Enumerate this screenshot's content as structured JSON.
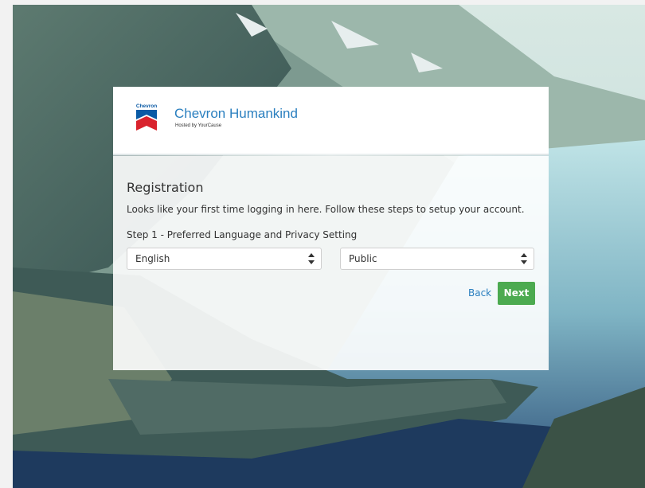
{
  "header": {
    "logo_text": "Chevron",
    "brand_name": "Chevron Humankind",
    "hosted_by": "Hosted by YourCause"
  },
  "registration": {
    "title": "Registration",
    "intro": "Looks like your first time logging in here. Follow these steps to setup your account.",
    "step_label": "Step 1 - Preferred Language and Privacy Setting",
    "language_select": {
      "selected": "English"
    },
    "privacy_select": {
      "selected": "Public"
    },
    "back_label": "Back",
    "next_label": "Next"
  },
  "colors": {
    "accent_blue": "#2a7fbf",
    "next_green": "#4caa50",
    "chevron_red": "#d9232d",
    "chevron_blue": "#0a5aa5"
  },
  "icons": {
    "logo": "chevron-logo-icon",
    "select_caret": "up-down-caret-icon"
  }
}
